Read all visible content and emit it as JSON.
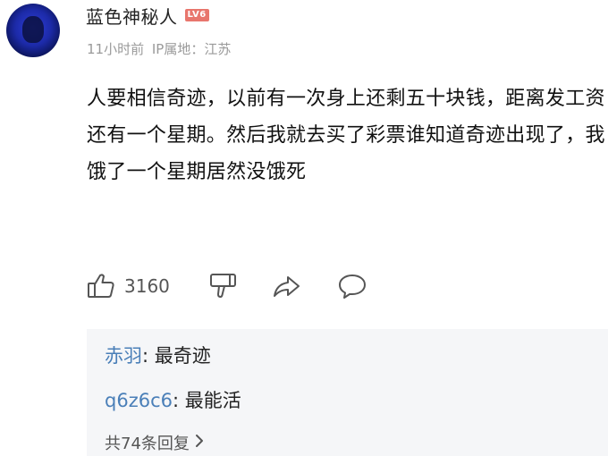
{
  "comment": {
    "username": "蓝色神秘人",
    "level_badge": "LV6",
    "time": "11小时前",
    "ip_location": "IP属地：江苏",
    "content": "人要相信奇迹，以前有一次身上还剩五十块钱，距离发工资还有一个星期。然后我就去买了彩票谁知道奇迹出现了，我饿了一个星期居然没饿死",
    "like_count": "3160",
    "icons": [
      "thumbs-up-icon",
      "thumbs-down-icon",
      "share-icon",
      "comment-bubble-icon",
      "chevron-right-icon"
    ],
    "colors": {
      "reply_author": "#4a7fb8",
      "level_badge": "#e8766d",
      "reply_background": "#f5f6f8",
      "meta_text": "#9a9a9a"
    }
  },
  "replies": {
    "items": [
      {
        "author": "赤羽",
        "separator": ": ",
        "text": "最奇迹"
      },
      {
        "author": "q6z6c6",
        "separator": ": ",
        "text": "最能活"
      }
    ],
    "total_label": "共74条回复"
  }
}
